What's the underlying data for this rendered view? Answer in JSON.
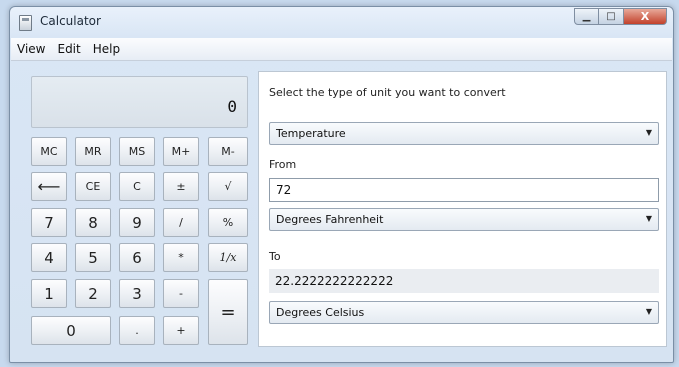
{
  "window": {
    "title": "Calculator"
  },
  "controls": {
    "minimize_icon": "minimize-icon",
    "maximize_icon": "maximize-icon",
    "close_label": "X"
  },
  "menu": [
    "View",
    "Edit",
    "Help"
  ],
  "display": {
    "value": "0"
  },
  "keys": {
    "mc": "MC",
    "mr": "MR",
    "ms": "MS",
    "mplus": "M+",
    "mminus": "M-",
    "backspace": "⟵",
    "ce": "CE",
    "c": "C",
    "plusminus": "±",
    "sqrt": "√",
    "seven": "7",
    "eight": "8",
    "nine": "9",
    "divide": "/",
    "percent": "%",
    "four": "4",
    "five": "5",
    "six": "6",
    "multiply": "*",
    "reciprocal": "1/x",
    "one": "1",
    "two": "2",
    "three": "3",
    "subtract": "-",
    "equals": "=",
    "zero": "0",
    "decimal": ".",
    "add": "+"
  },
  "converter": {
    "prompt": "Select the type of unit you want to convert",
    "unit_type": "Temperature",
    "from_label": "From",
    "from_value": "72",
    "from_unit": "Degrees Fahrenheit",
    "to_label": "To",
    "to_value": "22.2222222222222",
    "to_unit": "Degrees Celsius"
  },
  "colors": {
    "background": "#c7d9ee",
    "close_button": "#c2412a"
  }
}
